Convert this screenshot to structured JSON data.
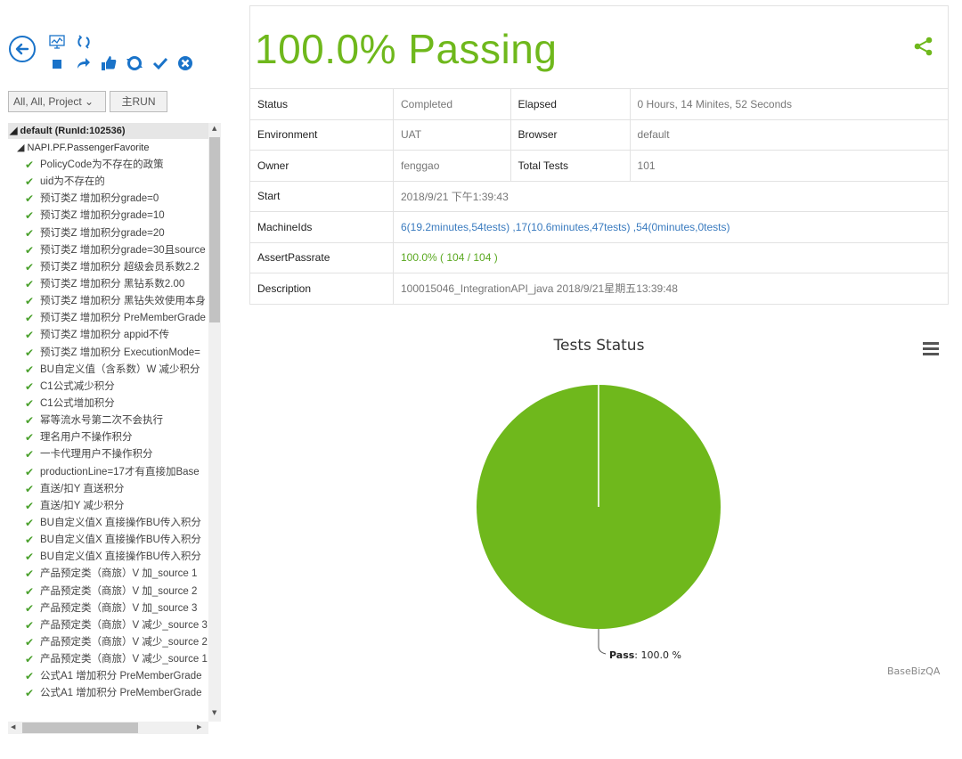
{
  "toolbar": {
    "icons": [
      "back-icon",
      "chart-icon",
      "refresh-icon",
      "stop-icon",
      "redo-icon",
      "thumbs-up-icon",
      "reset-icon",
      "check-icon",
      "cancel-icon"
    ]
  },
  "filter": {
    "select_value": "All, All, Project ⌄",
    "run_label": "主RUN"
  },
  "tree": {
    "root": "◢ default (RunId:102536)",
    "suite": "◢ NAPI.PF.PassengerFavorite",
    "check_glyph": "✔",
    "items": [
      "PolicyCode为不存在的政策",
      "uid为不存在的",
      "预订类Z 增加积分grade=0",
      "预订类Z 增加积分grade=10",
      "预订类Z 增加积分grade=20",
      "预订类Z 增加积分grade=30且source",
      "预订类Z 增加积分 超级会员系数2.2",
      "预订类Z 增加积分 黑钻系数2.00",
      "预订类Z 增加积分 黑钻失效使用本身",
      "预订类Z 增加积分 PreMemberGrade",
      "预订类Z 增加积分 appid不传",
      "预订类Z 增加积分 ExecutionMode=",
      "BU自定义值（含系数）W 减少积分",
      "C1公式减少积分",
      "C1公式增加积分",
      "幂等流水号第二次不会执行",
      "理名用户不操作积分",
      " 一卡代理用户不操作积分",
      "productionLine=17才有直接加Base",
      "直送/扣Y 直送积分",
      "直送/扣Y 减少积分",
      "BU自定义值X 直接操作BU传入积分",
      "BU自定义值X 直接操作BU传入积分",
      "BU自定义值X 直接操作BU传入积分",
      "产品预定类（商旅）V 加_source 1",
      "产品预定类（商旅）V 加_source 2",
      "产品预定类（商旅）V 加_source 3",
      "产品预定类（商旅）V 减少_source 3",
      "产品预定类（商旅）V 减少_source 2",
      "产品预定类（商旅）V 减少_source 1",
      "公式A1 增加积分 PreMemberGrade",
      "公式A1 增加积分 PreMemberGrade"
    ]
  },
  "summary": {
    "headline": "100.0% Passing",
    "rows": [
      {
        "k1": "Status",
        "v1": "Completed",
        "k2": "Elapsed",
        "v2": "0 Hours, 14 Minites, 52 Seconds"
      },
      {
        "k1": "Environment",
        "v1": "UAT",
        "k2": "Browser",
        "v2": "default"
      },
      {
        "k1": "Owner",
        "v1": "fenggao",
        "k2": "Total Tests",
        "v2": "101"
      }
    ],
    "start_label": "Start",
    "start_value": "2018/9/21 下午1:39:43",
    "machine_label": "MachineIds",
    "machine_value": "6(19.2minutes,54tests) ,17(10.6minutes,47tests) ,54(0minutes,0tests)",
    "assert_label": "AssertPassrate",
    "assert_value": "100.0% ( 104 / 104 )",
    "desc_label": "Description",
    "desc_value": "100015046_IntegrationAPI_java 2018/9/21星期五13:39:48"
  },
  "colors": {
    "accent": "#6fb81c",
    "pass": "#6fb81c",
    "link": "#3a7bbf"
  },
  "chart_data": {
    "type": "pie",
    "title": "Tests Status",
    "slices": [
      {
        "label": "Pass",
        "value": 100.0,
        "color": "#6fb81c"
      }
    ],
    "data_label_name": "Pass",
    "data_label_value": ": 100.0 %",
    "credit": "BaseBizQA"
  }
}
